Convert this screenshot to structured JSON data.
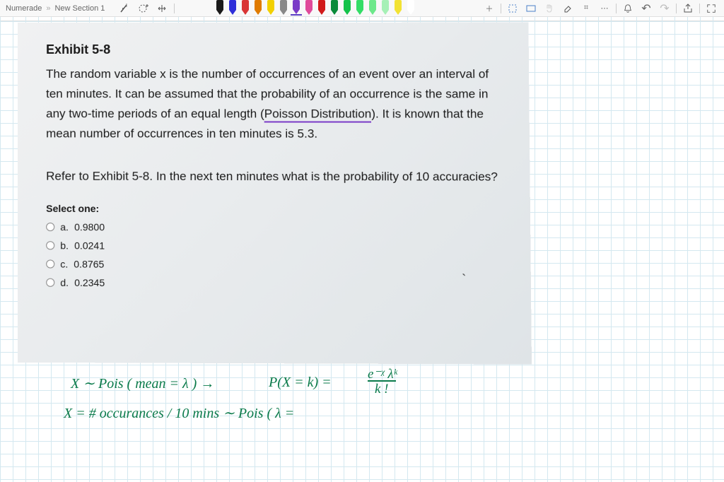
{
  "breadcrumb": {
    "root": "Numerade",
    "section": "New Section 1"
  },
  "pens": [
    {
      "color": "#1a1a1a"
    },
    {
      "color": "#2f2fd9"
    },
    {
      "color": "#d93636"
    },
    {
      "color": "#e07b00"
    },
    {
      "color": "#f2d000"
    },
    {
      "color": "#888888"
    },
    {
      "color": "#7a3bc7",
      "selected": true
    },
    {
      "color": "#e04a9a"
    },
    {
      "color": "#d11a1a"
    },
    {
      "color": "#0a8a3a"
    },
    {
      "color": "#14c24a"
    },
    {
      "color": "#33dd66"
    },
    {
      "color": "#6de88a"
    },
    {
      "color": "#a6f0b6"
    },
    {
      "color": "#f2e233"
    },
    {
      "color": "#ffffff"
    }
  ],
  "card": {
    "exhibit_title": "Exhibit 5-8",
    "body_before": "The random variable x is the number of occurrences of an event over an interval of ten minutes. It can be assumed that the probability of an occurrence is the same in any two-time periods of an equal length (",
    "poisson": "Poisson Distribution",
    "body_after": "). It is known that the mean number of occurrences in ten minutes is 5.3.",
    "prompt": "Refer to Exhibit 5-8. In the next ten minutes what is the probability of 10 accuracies?",
    "select_label": "Select one:",
    "options": [
      {
        "letter": "a.",
        "value": "0.9800"
      },
      {
        "letter": "b.",
        "value": "0.0241"
      },
      {
        "letter": "c.",
        "value": "0.8765"
      },
      {
        "letter": "d.",
        "value": "0.2345"
      }
    ]
  },
  "handwriting": {
    "line1a": "X ∼ Pois ( mean = λ )   →",
    "line1b": "P(X = k)  =",
    "frac_top": "e⁻ᵡ λᵏ",
    "frac_bot": "k !",
    "line2": "X  =  # occurances / 10 mins   ∼   Pois ( λ ="
  },
  "icons": {
    "text_insert": "⌨",
    "add_box": "⊕",
    "move": "✥",
    "plus": "＋",
    "lasso": "◫",
    "select": "▭",
    "hand": "✋",
    "eraser": "◇",
    "ruler": "⌗",
    "dots": "⋯",
    "bell": "🔔",
    "undo": "↶",
    "redo": "↷",
    "share": "↗",
    "fullscreen": "⛶"
  }
}
